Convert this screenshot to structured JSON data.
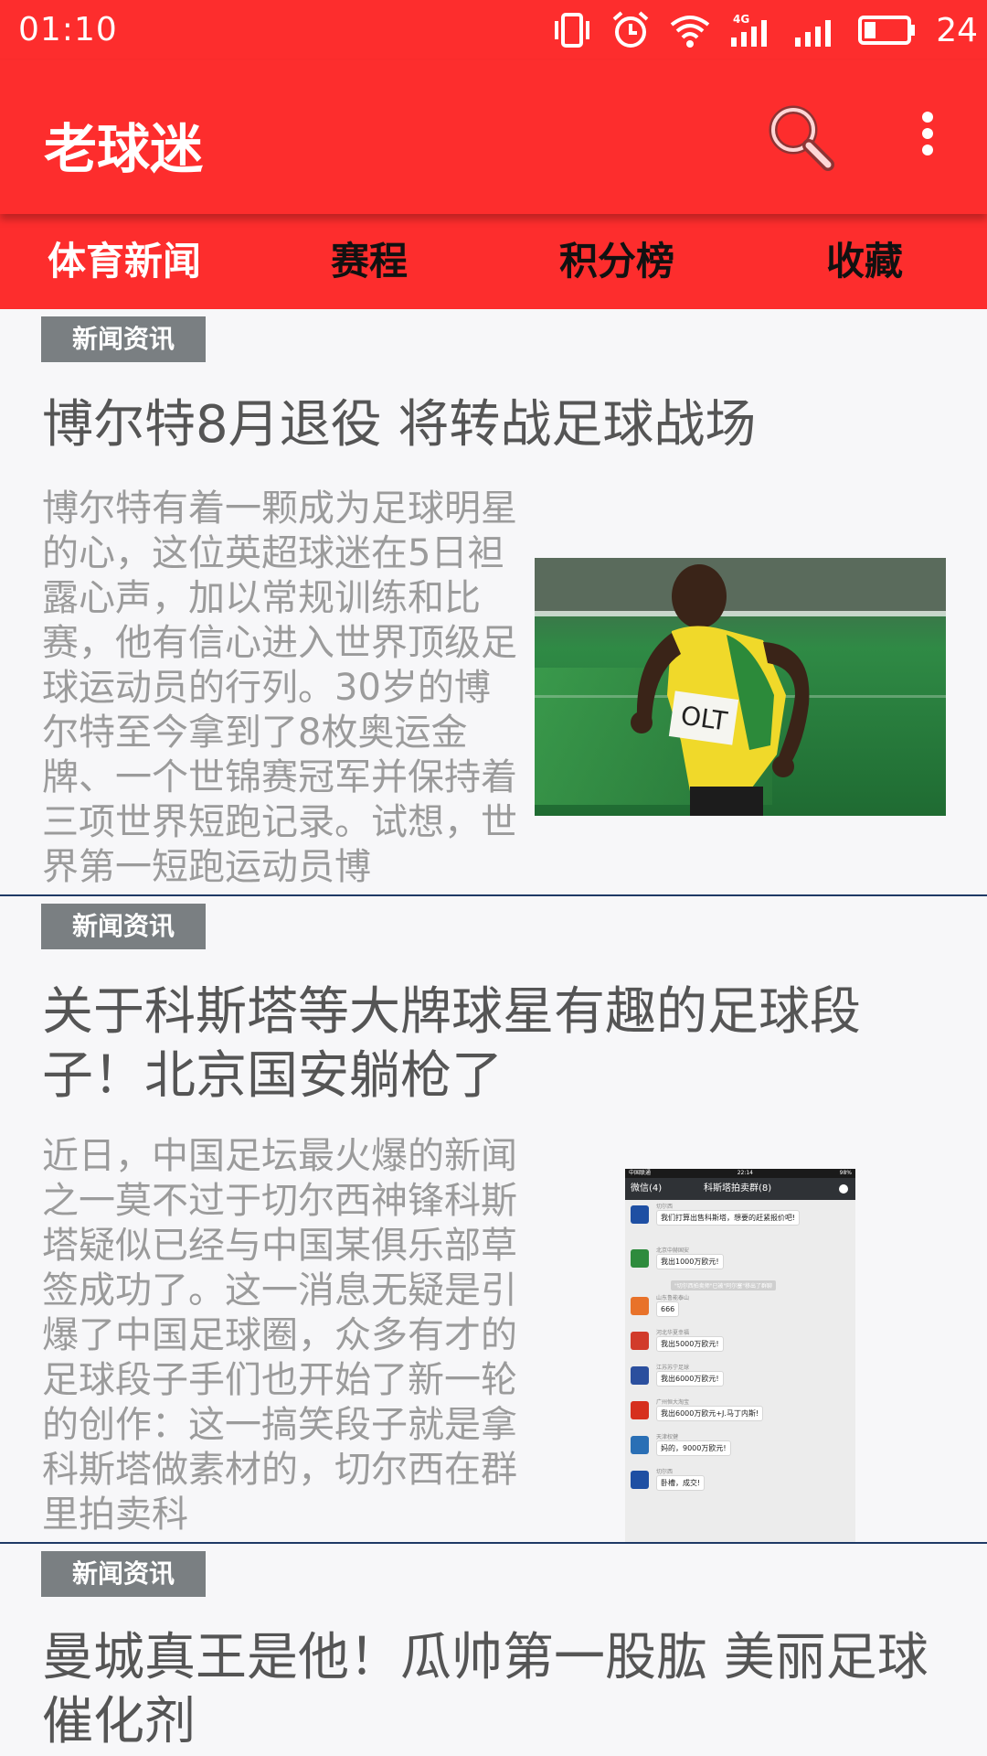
{
  "status": {
    "time": "01:10",
    "battery": "24",
    "network": "4G"
  },
  "app": {
    "title": "老球迷"
  },
  "tabs": [
    {
      "label": "体育新闻",
      "active": true
    },
    {
      "label": "赛程",
      "active": false
    },
    {
      "label": "积分榜",
      "active": false
    },
    {
      "label": "收藏",
      "active": false
    }
  ],
  "articles": [
    {
      "tag": "新闻资讯",
      "title": "博尔特8月退役 将转战足球战场",
      "summary": "博尔特有着一颗成为足球明星的心，这位英超球迷在5日袒露心声，加以常规训练和比赛，他有信心进入世界顶级足球运动员的行列。30岁的博尔特至今拿到了8枚奥运金牌、一个世锦赛冠军并保持着三项世界短跑记录。试想，世界第一短跑运动员博"
    },
    {
      "tag": "新闻资讯",
      "title": "关于科斯塔等大牌球星有趣的足球段子！北京国安躺枪了",
      "summary": "近日，中国足坛最火爆的新闻之一莫不过于切尔西神锋科斯塔疑似已经与中国某俱乐部草签成功了。这一消息无疑是引爆了中国足球圈，众多有才的足球段子手们也开始了新一轮的创作：这一搞笑段子就是拿科斯塔做素材的，切尔西在群里拍卖科",
      "chat": {
        "status_left": "中国联通",
        "status_time": "22:14",
        "status_right": "98%",
        "back": "微信(4)",
        "title": "科斯塔拍卖群(8)",
        "system_notice": "\"切尔西拍卖师\"已被\"阿尔塞\"移出了群聊",
        "messages": [
          {
            "sender": "切尔西",
            "text": "我们打算出售科斯塔，想要的赶紧报价吧!",
            "color": "#1e4fa3"
          },
          {
            "sender": "北京中赫国安",
            "text": "我出1000万欧元!",
            "color": "#2e8b3d"
          },
          {
            "sender": "山东鲁能泰山",
            "text": "666",
            "color": "#e8722a"
          },
          {
            "sender": "河北华夏幸福",
            "text": "我出5000万欧元!",
            "color": "#d13b2b"
          },
          {
            "sender": "江苏苏宁足球",
            "text": "我出6000万欧元!",
            "color": "#2b4f9e"
          },
          {
            "sender": "广州恒大淘宝",
            "text": "我出6000万欧元+J.马丁内斯!",
            "color": "#d6301e"
          },
          {
            "sender": "天津权健",
            "text": "妈的，9000万欧元!",
            "color": "#2a6fb5"
          },
          {
            "sender": "切尔西",
            "text": "卧槽，成交!",
            "color": "#1e4fa3"
          }
        ]
      }
    },
    {
      "tag": "新闻资讯",
      "title": "曼城真王是他！瓜帅第一股肱 美丽足球催化剂"
    }
  ]
}
